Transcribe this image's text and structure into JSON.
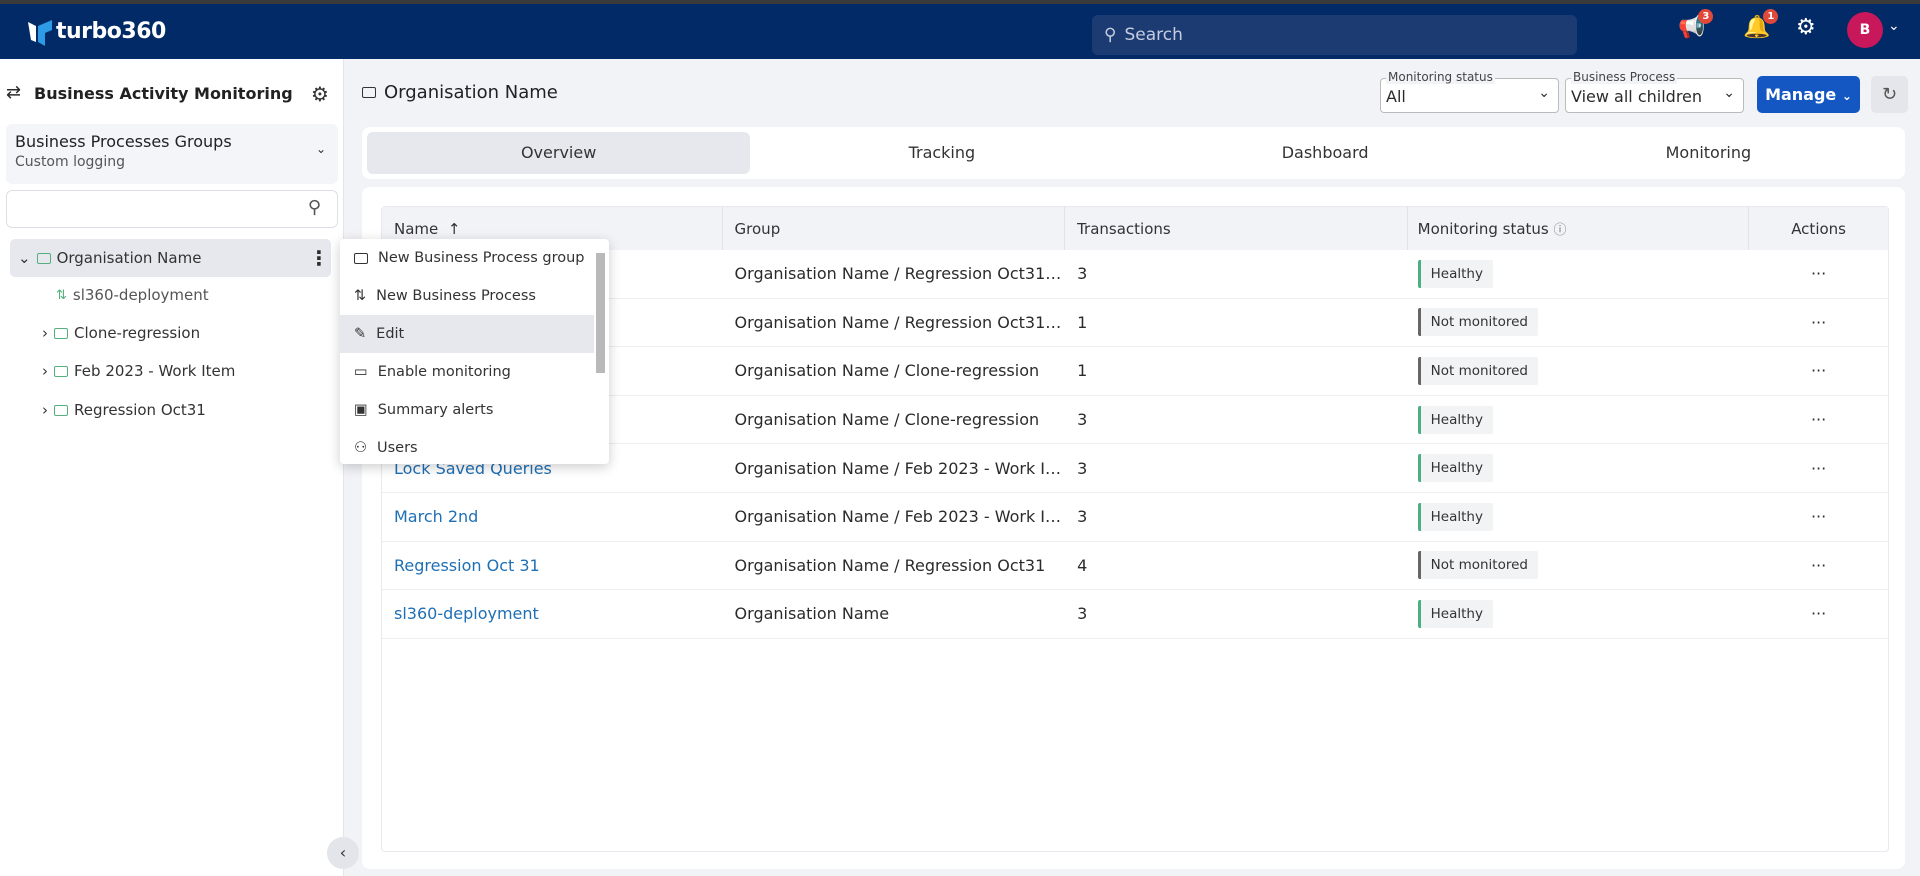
{
  "app": {
    "brand": "turbo360",
    "search_placeholder": "Search",
    "notifications_count": "3",
    "alerts_count": "1",
    "avatar_initial": "B",
    "accent": "#1457c2",
    "header_bg": "#012a66"
  },
  "sidebar": {
    "title": "Business Activity Monitoring",
    "group_select": {
      "title": "Business Processes Groups",
      "subtitle": "Custom logging"
    },
    "search_value": "",
    "tree": [
      {
        "label": "Organisation Name",
        "expanded": true
      },
      {
        "label": "sl360-deployment"
      },
      {
        "label": "Clone-regression"
      },
      {
        "label": "Feb 2023 - Work Item"
      },
      {
        "label": "Regression Oct31"
      }
    ]
  },
  "context_menu": {
    "items": [
      {
        "label": "New Business Process group",
        "icon": "folder-icon"
      },
      {
        "label": "New Business Process",
        "icon": "process-icon"
      },
      {
        "label": "Edit",
        "icon": "edit-icon",
        "highlighted": true
      },
      {
        "label": "Enable monitoring",
        "icon": "monitor-icon"
      },
      {
        "label": "Summary alerts",
        "icon": "alert-icon"
      },
      {
        "label": "Users",
        "icon": "users-icon"
      }
    ]
  },
  "main": {
    "title": "Organisation Name",
    "filters": {
      "monitoring_status": {
        "label": "Monitoring status",
        "value": "All"
      },
      "business_process": {
        "label": "Business Process",
        "value": "View all children"
      }
    },
    "manage_label": "Manage",
    "tabs": [
      {
        "label": "Overview",
        "active": true
      },
      {
        "label": "Tracking"
      },
      {
        "label": "Dashboard"
      },
      {
        "label": "Monitoring"
      }
    ],
    "table": {
      "headers": [
        "Name",
        "Group",
        "Transactions",
        "Monitoring status",
        "Actions"
      ],
      "rows": [
        {
          "name": "",
          "group": "Organisation Name / Regression Oct31 ...",
          "transactions": "3",
          "status": "Healthy"
        },
        {
          "name": "",
          "group": "Organisation Name / Regression Oct31 ...",
          "transactions": "1",
          "status": "Not monitored"
        },
        {
          "name": "",
          "group": "Organisation Name / Clone-regression",
          "transactions": "1",
          "status": "Not monitored"
        },
        {
          "name": "",
          "group": "Organisation Name / Clone-regression",
          "transactions": "3",
          "status": "Healthy"
        },
        {
          "name": "Lock Saved Queries",
          "group": "Organisation Name / Feb 2023 - Work It...",
          "transactions": "3",
          "status": "Healthy"
        },
        {
          "name": "March 2nd",
          "group": "Organisation Name / Feb 2023 - Work It...",
          "transactions": "3",
          "status": "Healthy"
        },
        {
          "name": "Regression Oct 31",
          "group": "Organisation Name / Regression Oct31",
          "transactions": "4",
          "status": "Not monitored"
        },
        {
          "name": "sl360-deployment",
          "group": "Organisation Name",
          "transactions": "3",
          "status": "Healthy"
        }
      ]
    }
  }
}
